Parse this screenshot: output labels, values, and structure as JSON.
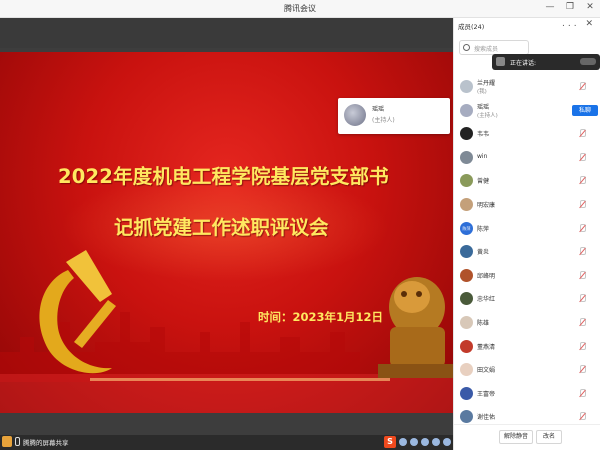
{
  "window": {
    "title": "腾讯会议",
    "controls": [
      "minimize",
      "restore",
      "close"
    ]
  },
  "slide": {
    "title_line1": "2022年度机电工程学院基层党支部书",
    "title_line2": "记抓党建工作述职评议会",
    "time": "时间：2023年1月12日",
    "colors": {
      "background": "#d0150f",
      "text": "#ffe860",
      "emblem": "#e8b020"
    }
  },
  "speaker_card": {
    "name": "瑶瑶",
    "role": "(主持人)"
  },
  "bottom_bar": {
    "share_label": "腾腾的屏幕共享",
    "sogou_label": "S"
  },
  "panel": {
    "title": "成员(24)",
    "more": "...",
    "search_placeholder": "搜索成员",
    "speaking_label": "正在讲话:",
    "participants": [
      {
        "name": "兰丹耀",
        "role": "(我)",
        "avatar_color": "#b9c2cc",
        "muted": true
      },
      {
        "name": "瑶瑶",
        "role": "(主持人)",
        "avatar_color": "#a6acc0",
        "muted": false,
        "badge": "私聊"
      },
      {
        "name": "韦韦",
        "role": "",
        "avatar_color": "#222222",
        "muted": true
      },
      {
        "name": "win",
        "role": "",
        "avatar_color": "#7f8a96",
        "muted": true
      },
      {
        "name": "曾健",
        "role": "",
        "avatar_color": "#8a9a5a",
        "muted": true
      },
      {
        "name": "明宏康",
        "role": "",
        "avatar_color": "#c4a07a",
        "muted": true
      },
      {
        "name": "陈萍",
        "role": "",
        "avatar_color": "#2e6fd8",
        "avatar_text": "陈萍",
        "muted": true
      },
      {
        "name": "黄炎",
        "role": "",
        "avatar_color": "#3a6a9a",
        "muted": true
      },
      {
        "name": "邱峰明",
        "role": "",
        "avatar_color": "#b0522a",
        "muted": true
      },
      {
        "name": "忠华红",
        "role": "",
        "avatar_color": "#4a5a3a",
        "muted": true
      },
      {
        "name": "陈雄",
        "role": "",
        "avatar_color": "#d8c8b8",
        "muted": true
      },
      {
        "name": "董燕清",
        "role": "",
        "avatar_color": "#c23a2a",
        "muted": true
      },
      {
        "name": "田文娟",
        "role": "",
        "avatar_color": "#e8d0c0",
        "muted": true
      },
      {
        "name": "王富帝",
        "role": "",
        "avatar_color": "#3a5aa8",
        "muted": true
      },
      {
        "name": "谢佳佑",
        "role": "",
        "avatar_color": "#5a7aa0",
        "muted": true
      }
    ],
    "buttons": {
      "unmute_all": "解除静音",
      "rename": "改名"
    }
  }
}
